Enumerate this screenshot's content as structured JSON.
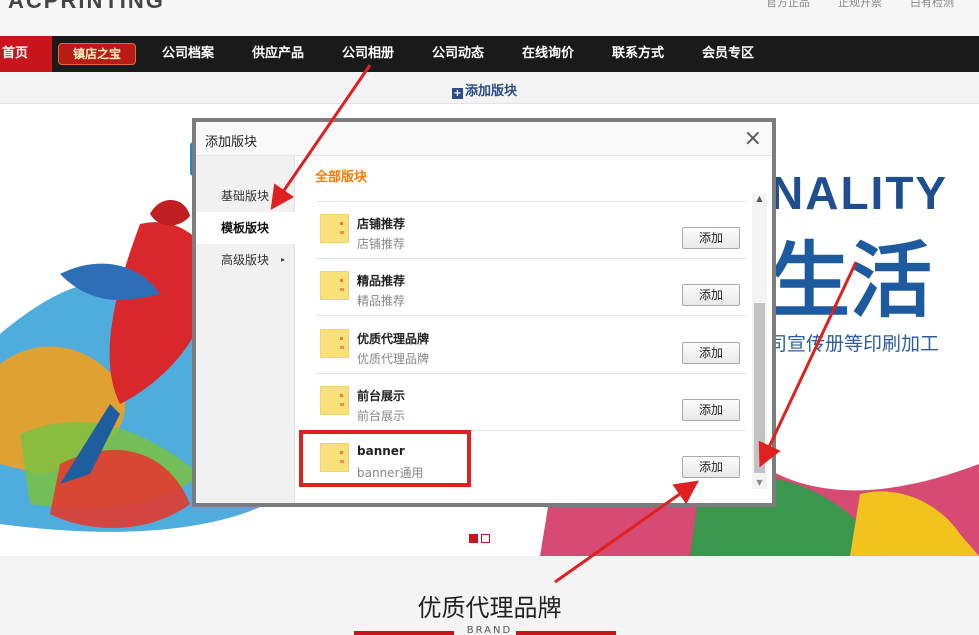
{
  "topbar": {
    "logo": "ACPRINTING",
    "links": [
      "官方正品",
      "正规开票",
      "白有检测"
    ]
  },
  "nav": {
    "home": "首页",
    "badge": "镇店之宝",
    "items": [
      "公司档案",
      "供应产品",
      "公司相册",
      "公司动态",
      "在线询价",
      "联系方式",
      "会员专区"
    ]
  },
  "addrow": {
    "label": "添加版块"
  },
  "banner": {
    "big_text": "NALITY",
    "cn_text": "生活",
    "sub_text": "司宣传册等印刷加工"
  },
  "modal": {
    "title": "添加版块",
    "close": "×",
    "side_items": [
      {
        "label": "基础版块",
        "active": false,
        "has_arrow": false
      },
      {
        "label": "模板版块",
        "active": true,
        "has_arrow": false
      },
      {
        "label": "高级版块",
        "active": false,
        "has_arrow": true
      }
    ],
    "side_arrow": "▸",
    "section_title": "全部版块",
    "rows": [
      {
        "name": "店铺推荐",
        "desc": "店铺推荐",
        "button": "添加"
      },
      {
        "name": "精品推荐",
        "desc": "精品推荐",
        "button": "添加"
      },
      {
        "name": "优质代理品牌",
        "desc": "优质代理品牌",
        "button": "添加"
      },
      {
        "name": "前台展示",
        "desc": "前台展示",
        "button": "添加"
      },
      {
        "name": "banner",
        "desc": "banner通用",
        "button": "添加"
      }
    ],
    "scroll_up": "▲",
    "scroll_down": "▼"
  },
  "section": {
    "title": "优质代理品牌",
    "subtitle": "BRAND"
  },
  "colors": {
    "nav_bg": "#1a1a1a",
    "brand_red": "#c9141b",
    "accent_orange": "#ff7a00",
    "annotation_red": "#e02020"
  }
}
